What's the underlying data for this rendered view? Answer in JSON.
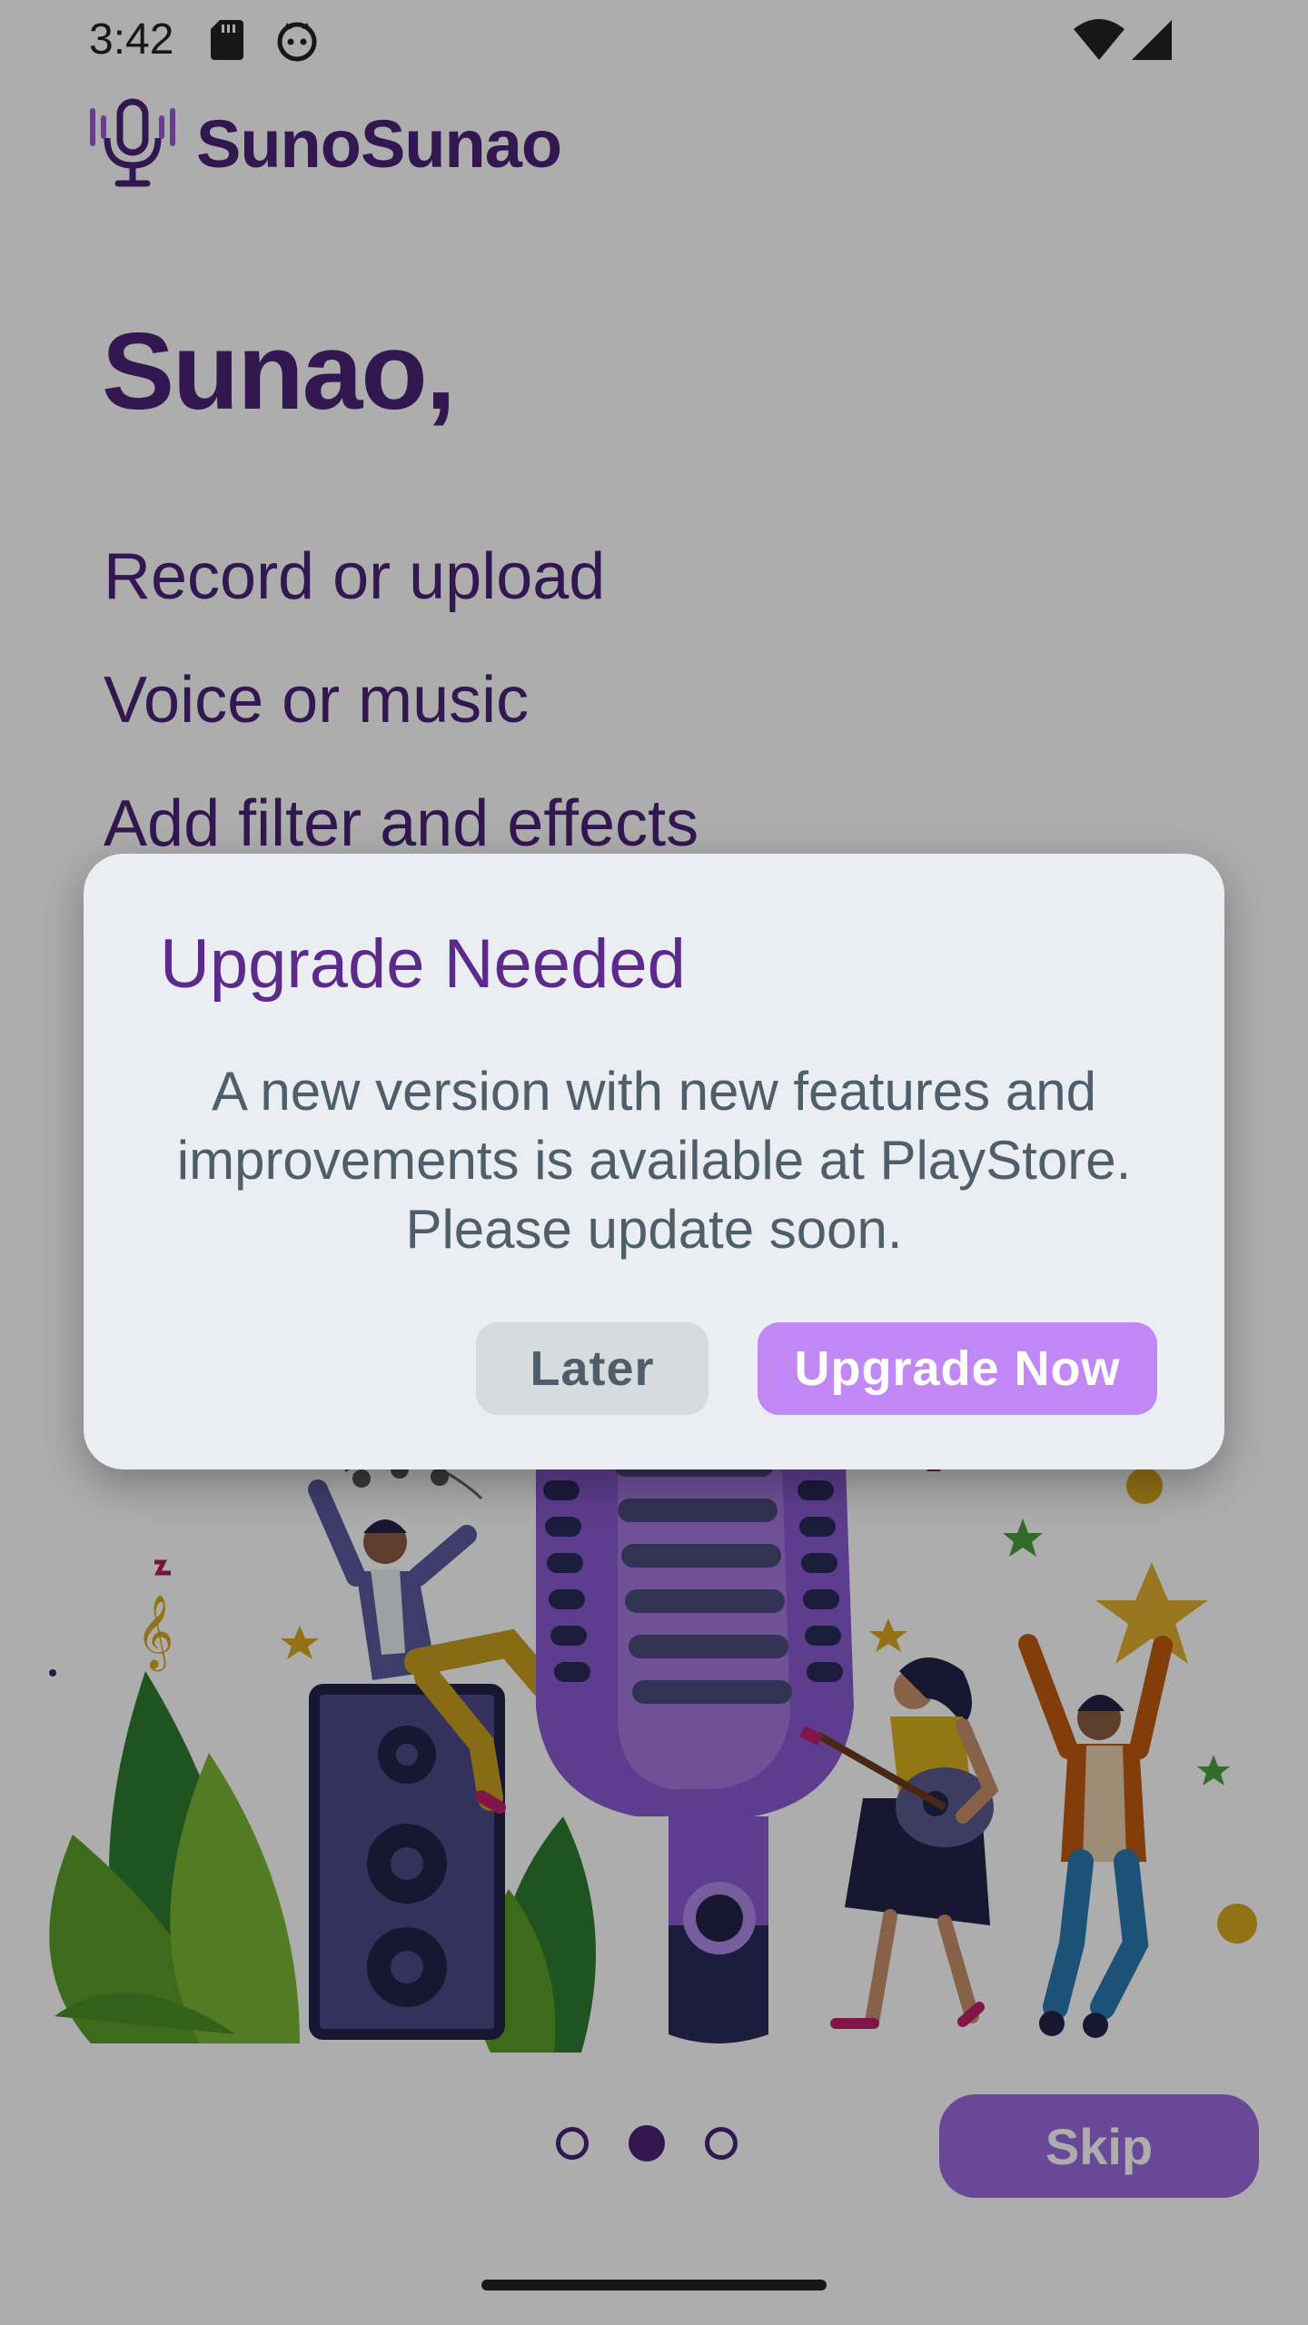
{
  "status_bar": {
    "time": "3:42",
    "icons": [
      "sd-card-icon",
      "notification-face-icon",
      "wifi-icon",
      "cell-signal-icon"
    ]
  },
  "brand": {
    "name": "SunoSunao",
    "logo_icon": "microphone-icon"
  },
  "onboarding": {
    "headline": "Sunao,",
    "features": [
      "Record or upload",
      "Voice or music",
      "Add filter and effects"
    ],
    "pager": {
      "total": 3,
      "active_index": 1
    },
    "skip_label": "Skip"
  },
  "dialog": {
    "title": "Upgrade Needed",
    "message": "A new version with new features and improvements is available at PlayStore. Please update soon.",
    "later_label": "Later",
    "upgrade_label": "Upgrade Now"
  },
  "colors": {
    "brand_purple": "#4a2377",
    "dialog_title": "#5c2a8a",
    "upgrade_button": "#c187f5",
    "later_button": "#d6dbde",
    "skip_button": "#9c6be0",
    "dialog_background": "#eaedf1"
  }
}
